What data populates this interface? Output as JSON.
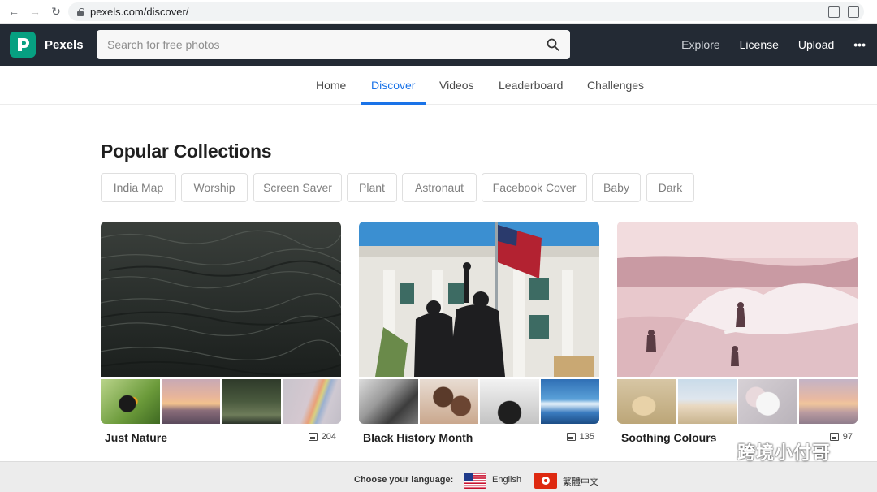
{
  "browser": {
    "url": "pexels.com/discover/"
  },
  "header": {
    "brand": "Pexels",
    "search_placeholder": "Search for free photos",
    "nav": [
      "Explore",
      "License",
      "Upload"
    ],
    "more": "•••"
  },
  "subnav": {
    "tabs": [
      "Home",
      "Discover",
      "Videos",
      "Leaderboard",
      "Challenges"
    ],
    "active": "Discover"
  },
  "main": {
    "heading": "Popular Collections",
    "chips": [
      "India Map",
      "Worship",
      "Screen Saver",
      "Plant",
      "Astronaut",
      "Facebook Cover",
      "Baby",
      "Dark"
    ],
    "collections": [
      {
        "title": "Just Nature",
        "count": "204"
      },
      {
        "title": "Black History Month",
        "count": "135"
      },
      {
        "title": "Soothing Colours",
        "count": "97"
      }
    ]
  },
  "footer": {
    "label": "Choose your language:",
    "languages": [
      "English",
      "繁體中文"
    ]
  },
  "watermark": {
    "text": "跨境小付哥"
  },
  "colors": {
    "topbar": "#232a34",
    "brand": "#07a081",
    "active_tab": "#1a73e8"
  }
}
